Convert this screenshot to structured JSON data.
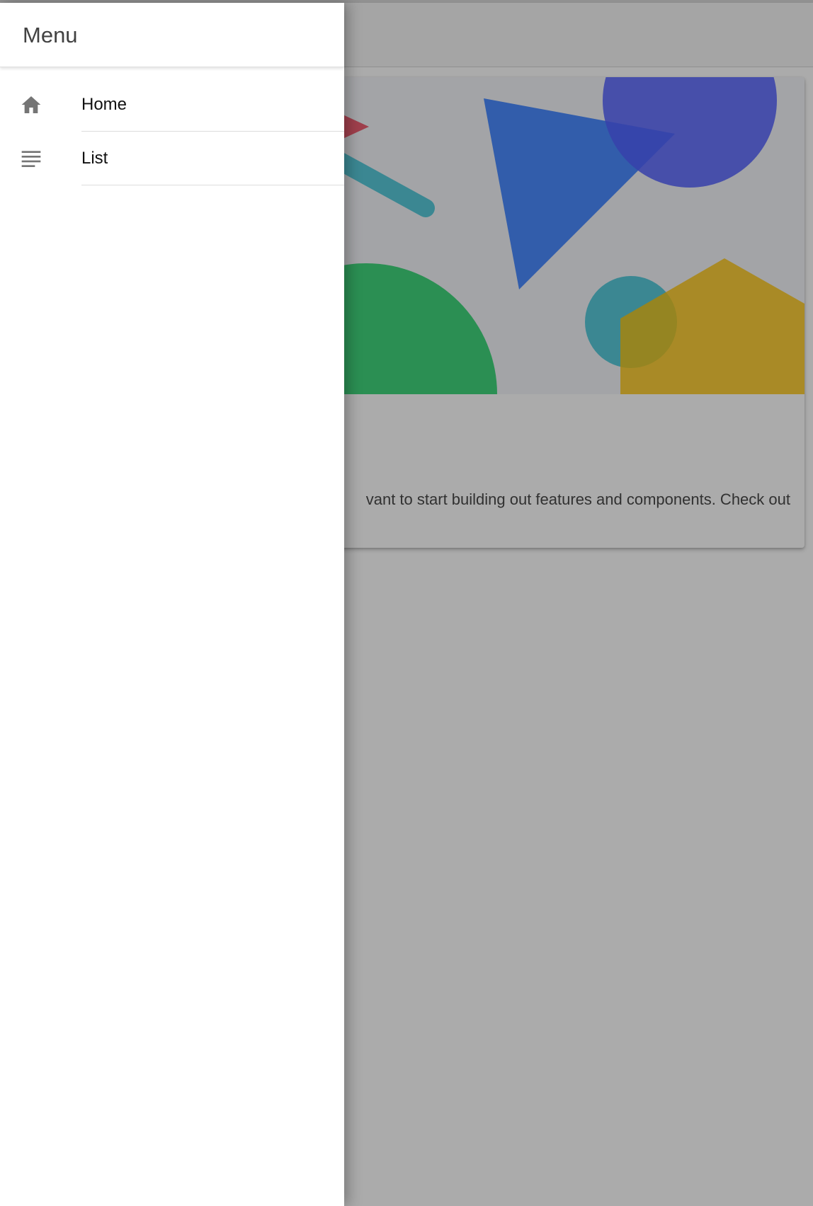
{
  "menu": {
    "title": "Menu",
    "items": [
      {
        "label": "Home",
        "icon": "home-icon"
      },
      {
        "label": "List",
        "icon": "list-icon"
      }
    ]
  },
  "card": {
    "text": "vant to start building out features and components. Check out"
  },
  "colors": {
    "backdrop": "rgba(0,0,0,0.33)",
    "drawer_background": "#ffffff",
    "icon": "#757575",
    "shape_red": "#eb445a",
    "shape_teal": "#3dc2d5",
    "shape_blue": "#3880ff",
    "shape_purple": "#5260ff",
    "shape_green": "#2dd36f",
    "shape_yellow": "#ffc409"
  }
}
